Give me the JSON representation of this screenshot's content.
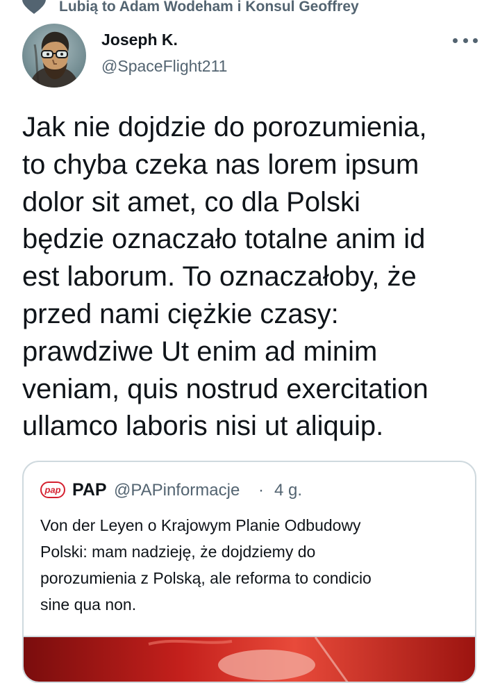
{
  "social_context": {
    "text": "Lubią to Adam Wodeham i Konsul Geoffrey",
    "icon": "heart-icon"
  },
  "author": {
    "name": "Joseph K.",
    "handle": "@SpaceFlight211",
    "avatar": "painted-portrait-with-glasses"
  },
  "menu": {
    "icon": "more-options-icon"
  },
  "tweet": {
    "text": "Jak nie dojdzie do porozumienia,\nto chyba czeka nas lorem ipsum\ndolor sit amet, co dla Polski\nbędzie oznaczało totalne anim id\nest laborum. To oznaczałoby, że\nprzed nami ciężkie czasy:\nprawdziwe Ut enim ad minim\nveniam, quis nostrud exercitation\nullamco laboris nisi ut aliquip."
  },
  "quoted_tweet": {
    "logo_text": "pap",
    "name": "PAP",
    "handle": "@PAPinformacje",
    "separator": "·",
    "time": "4 g.",
    "text": "Von der Leyen o Krajowym Planie Odbudowy\nPolski: mam nadzieję, że dojdziemy do\nporozumienia z Polską, ale reforma to condicio\nsine qua non.",
    "image": "red-media-preview"
  },
  "colors": {
    "text_primary": "#0f1419",
    "text_secondary": "#536471",
    "border": "#cfd9de",
    "pap_red": "#d4202f"
  }
}
